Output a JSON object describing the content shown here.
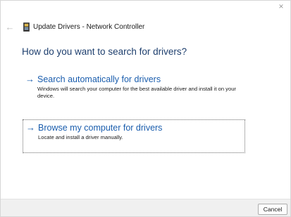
{
  "titlebar": {
    "back_icon": "back-arrow-icon",
    "app_icon": "device-manager-icon",
    "title": "Update Drivers - Network Controller",
    "close_icon": "close-icon",
    "back_glyph": "←",
    "close_glyph": "×"
  },
  "main": {
    "heading": "How do you want to search for drivers?",
    "options": [
      {
        "arrow_glyph": "→",
        "title": "Search automatically for drivers",
        "description": "Windows will search your computer for the best available driver and install it on your device."
      },
      {
        "arrow_glyph": "→",
        "title": "Browse my computer for drivers",
        "description": "Locate and install a driver manually."
      }
    ]
  },
  "footer": {
    "cancel_label": "Cancel"
  },
  "colors": {
    "link": "#1a5dad",
    "heading": "#1e3f6e",
    "footer_bg": "#f0f0f0"
  }
}
